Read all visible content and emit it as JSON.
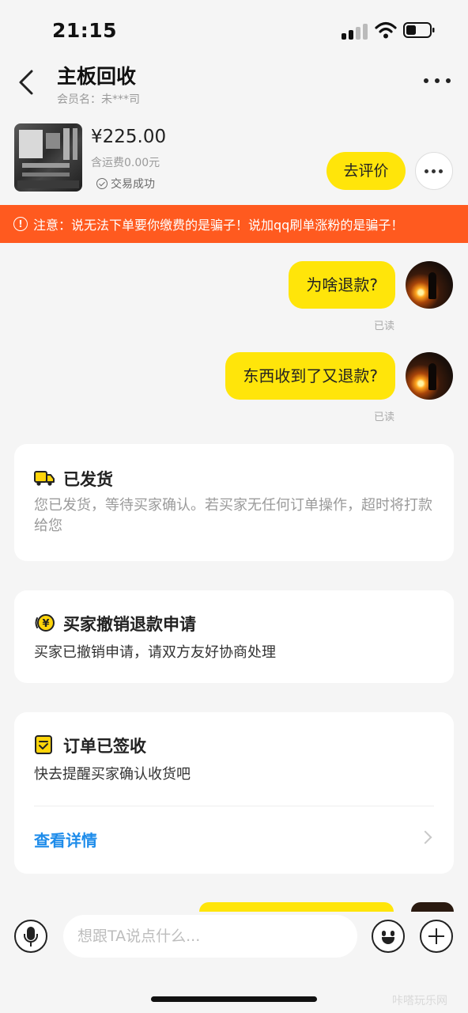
{
  "status_bar": {
    "time": "21:15"
  },
  "header": {
    "title": "主板回收",
    "subtitle": "会员名：未***司"
  },
  "product": {
    "price": "¥225.00",
    "shipping": "含运费0.00元",
    "status": "交易成功",
    "rate_button": "去评价"
  },
  "warning": {
    "text": "注意：说无法下单要你缴费的是骗子！说加qq刷单涨粉的是骗子！"
  },
  "messages": [
    {
      "text": "为啥退款?",
      "status": "已读"
    },
    {
      "text": "东西收到了又退款?",
      "status": "已读"
    }
  ],
  "cards": [
    {
      "icon": "truck-icon",
      "title": "已发货",
      "text": "您已发货，等待买家确认。若买家无任何订单操作，超时将打款给您"
    },
    {
      "icon": "refund-icon",
      "title": "买家撤销退款申请",
      "text": "买家已撤销申请，请双方友好协商处理"
    },
    {
      "icon": "signed-icon",
      "title": "订单已签收",
      "text": "快去提醒买家确认收货吧",
      "link": "查看详情"
    }
  ],
  "input": {
    "placeholder": "想跟TA说点什么..."
  },
  "watermark": "咔嗒玩乐网",
  "colors": {
    "accent": "#ffe50a",
    "warning": "#ff5a1f",
    "link": "#1e8cea"
  }
}
